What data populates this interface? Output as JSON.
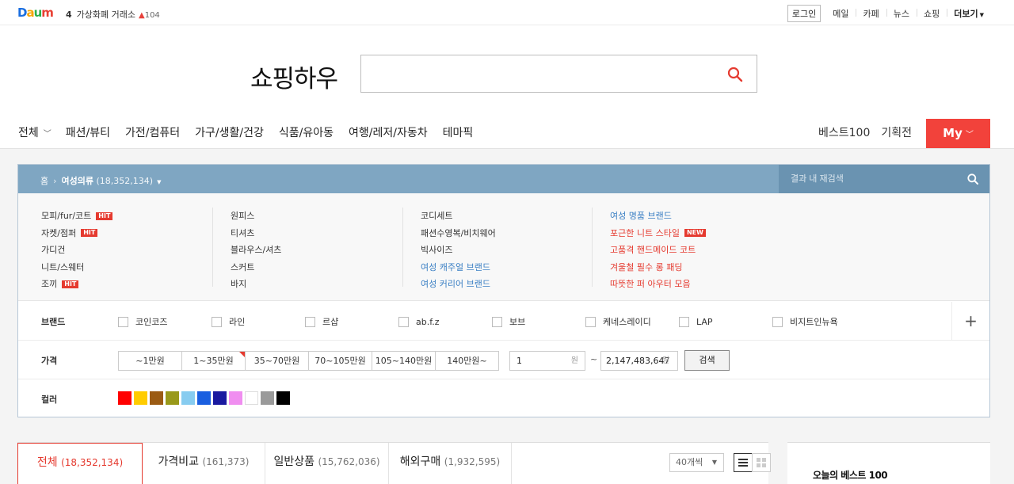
{
  "topbar": {
    "logo": "Daum",
    "trend_rank": "4",
    "trend_text": "가상화폐 거래소",
    "trend_change": "104",
    "login": "로그인",
    "links": [
      "메일",
      "카페",
      "뉴스",
      "쇼핑"
    ],
    "more": "더보기"
  },
  "header": {
    "brand": "쇼핑하우",
    "search_value": ""
  },
  "nav": {
    "categories": [
      "전체",
      "패션/뷰티",
      "가전/컴퓨터",
      "가구/생활/건강",
      "식품/유아동",
      "여행/레저/자동차",
      "테마픽"
    ],
    "right": [
      "베스트100",
      "기획전"
    ],
    "my": "My"
  },
  "panel": {
    "home": "홈",
    "current": "여성의류",
    "count": "(18,352,134)",
    "research_placeholder": "결과 내 재검색",
    "columns": [
      [
        {
          "label": "모피/fur/코트",
          "badge": "HIT"
        },
        {
          "label": "자켓/점퍼",
          "badge": "HIT"
        },
        {
          "label": "가디건",
          "badge": ""
        },
        {
          "label": "니트/스웨터",
          "badge": ""
        },
        {
          "label": "조끼",
          "badge": "HIT"
        }
      ],
      [
        {
          "label": "원피스"
        },
        {
          "label": "티셔츠"
        },
        {
          "label": "블라우스/셔츠"
        },
        {
          "label": "스커트"
        },
        {
          "label": "바지"
        }
      ],
      [
        {
          "label": "코디세트",
          "tone": "default"
        },
        {
          "label": "패션수영복/비치웨어",
          "tone": "default"
        },
        {
          "label": "빅사이즈",
          "tone": "default"
        },
        {
          "label": "여성 캐주얼 브랜드",
          "tone": "blue"
        },
        {
          "label": "여성 커리어 브랜드",
          "tone": "blue"
        }
      ],
      [
        {
          "label": "여성 명품 브랜드",
          "tone": "blue"
        },
        {
          "label": "포근한 니트 스타일",
          "tone": "red",
          "badge": "NEW"
        },
        {
          "label": "고품격 핸드메이드 코트",
          "tone": "red"
        },
        {
          "label": "겨울철 필수 롱 패딩",
          "tone": "red"
        },
        {
          "label": "따뜻한 퍼 아우터 모음",
          "tone": "red"
        }
      ]
    ],
    "brand_label": "브랜드",
    "brands": [
      "코인코즈",
      "라인",
      "르샵",
      "ab.f.z",
      "보브",
      "케네스레이디",
      "LAP",
      "비지트인뉴욕"
    ],
    "price_label": "가격",
    "price_ranges": [
      "~1만원",
      "1~35만원",
      "35~70만원",
      "70~105만원",
      "105~140만원",
      "140만원~"
    ],
    "price_min": "1",
    "price_max": "2,147,483,647",
    "won": "원",
    "tilde": "~",
    "search_btn": "검색",
    "color_label": "컬러",
    "colors": [
      "#ff0000",
      "#ffcc00",
      "#9b5b13",
      "#99991a",
      "#87ccf0",
      "#1a5fe0",
      "#1a1aa0",
      "#f08ef0",
      "#ffffff",
      "#9a9a9a",
      "#000000"
    ]
  },
  "tabs": [
    {
      "label": "전체",
      "count": "(18,352,134)"
    },
    {
      "label": "가격비교",
      "count": "(161,373)"
    },
    {
      "label": "일반상품",
      "count": "(15,762,036)"
    },
    {
      "label": "해외구매",
      "count": "(1,932,595)"
    }
  ],
  "perpage": "40개씩",
  "best_title": "오늘의 베스트 100"
}
